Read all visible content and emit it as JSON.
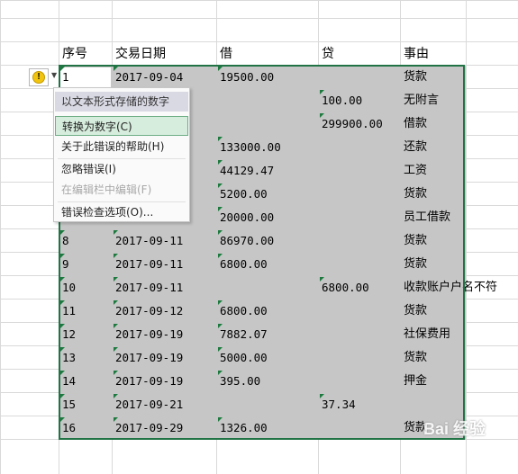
{
  "headers": {
    "seq": "序号",
    "date": "交易日期",
    "debit": "借",
    "credit": "贷",
    "reason": "事由"
  },
  "rows": [
    {
      "seq": "1",
      "date": "2017-09-04",
      "debit": "19500.00",
      "credit": "",
      "reason": "货款"
    },
    {
      "seq": "",
      "date": "",
      "debit": "",
      "credit": "100.00",
      "reason": "无附言"
    },
    {
      "seq": "",
      "date": "",
      "debit": "",
      "credit": "299900.00",
      "reason": "借款"
    },
    {
      "seq": "",
      "date": "",
      "debit": "133000.00",
      "credit": "",
      "reason": "还款"
    },
    {
      "seq": "",
      "date": "",
      "debit": "44129.47",
      "credit": "",
      "reason": "工资"
    },
    {
      "seq": "",
      "date": "",
      "debit": "5200.00",
      "credit": "",
      "reason": "货款"
    },
    {
      "seq": "",
      "date": "",
      "debit": "20000.00",
      "credit": "",
      "reason": "员工借款"
    },
    {
      "seq": "8",
      "date": "2017-09-11",
      "debit": "86970.00",
      "credit": "",
      "reason": "货款"
    },
    {
      "seq": "9",
      "date": "2017-09-11",
      "debit": "6800.00",
      "credit": "",
      "reason": "货款"
    },
    {
      "seq": "10",
      "date": "2017-09-11",
      "debit": "",
      "credit": "6800.00",
      "reason": "收款账户户名不符"
    },
    {
      "seq": "11",
      "date": "2017-09-12",
      "debit": "6800.00",
      "credit": "",
      "reason": "货款"
    },
    {
      "seq": "12",
      "date": "2017-09-19",
      "debit": "7882.07",
      "credit": "",
      "reason": "社保费用"
    },
    {
      "seq": "13",
      "date": "2017-09-19",
      "debit": "5000.00",
      "credit": "",
      "reason": "货款"
    },
    {
      "seq": "14",
      "date": "2017-09-19",
      "debit": "395.00",
      "credit": "",
      "reason": "押金"
    },
    {
      "seq": "15",
      "date": "2017-09-21",
      "debit": "",
      "credit": "37.34",
      "reason": ""
    },
    {
      "seq": "16",
      "date": "2017-09-29",
      "debit": "1326.00",
      "credit": "",
      "reason": "货款"
    }
  ],
  "menu": {
    "title": "以文本形式存储的数字",
    "convert": "转换为数字(C)",
    "help": "关于此错误的帮助(H)",
    "ignore": "忽略错误(I)",
    "edit_in_bar": "在编辑栏中编辑(F)",
    "options": "错误检查选项(O)..."
  },
  "warning_icon": {
    "name": "warning-icon",
    "glyph": "!"
  },
  "watermark": "Bai 经验",
  "colors": {
    "selection_border": "#217346",
    "selection_fill": "#c6c6c6",
    "error_triangle": "#1d7a3e",
    "menu_highlight": "#d6ecdc"
  }
}
